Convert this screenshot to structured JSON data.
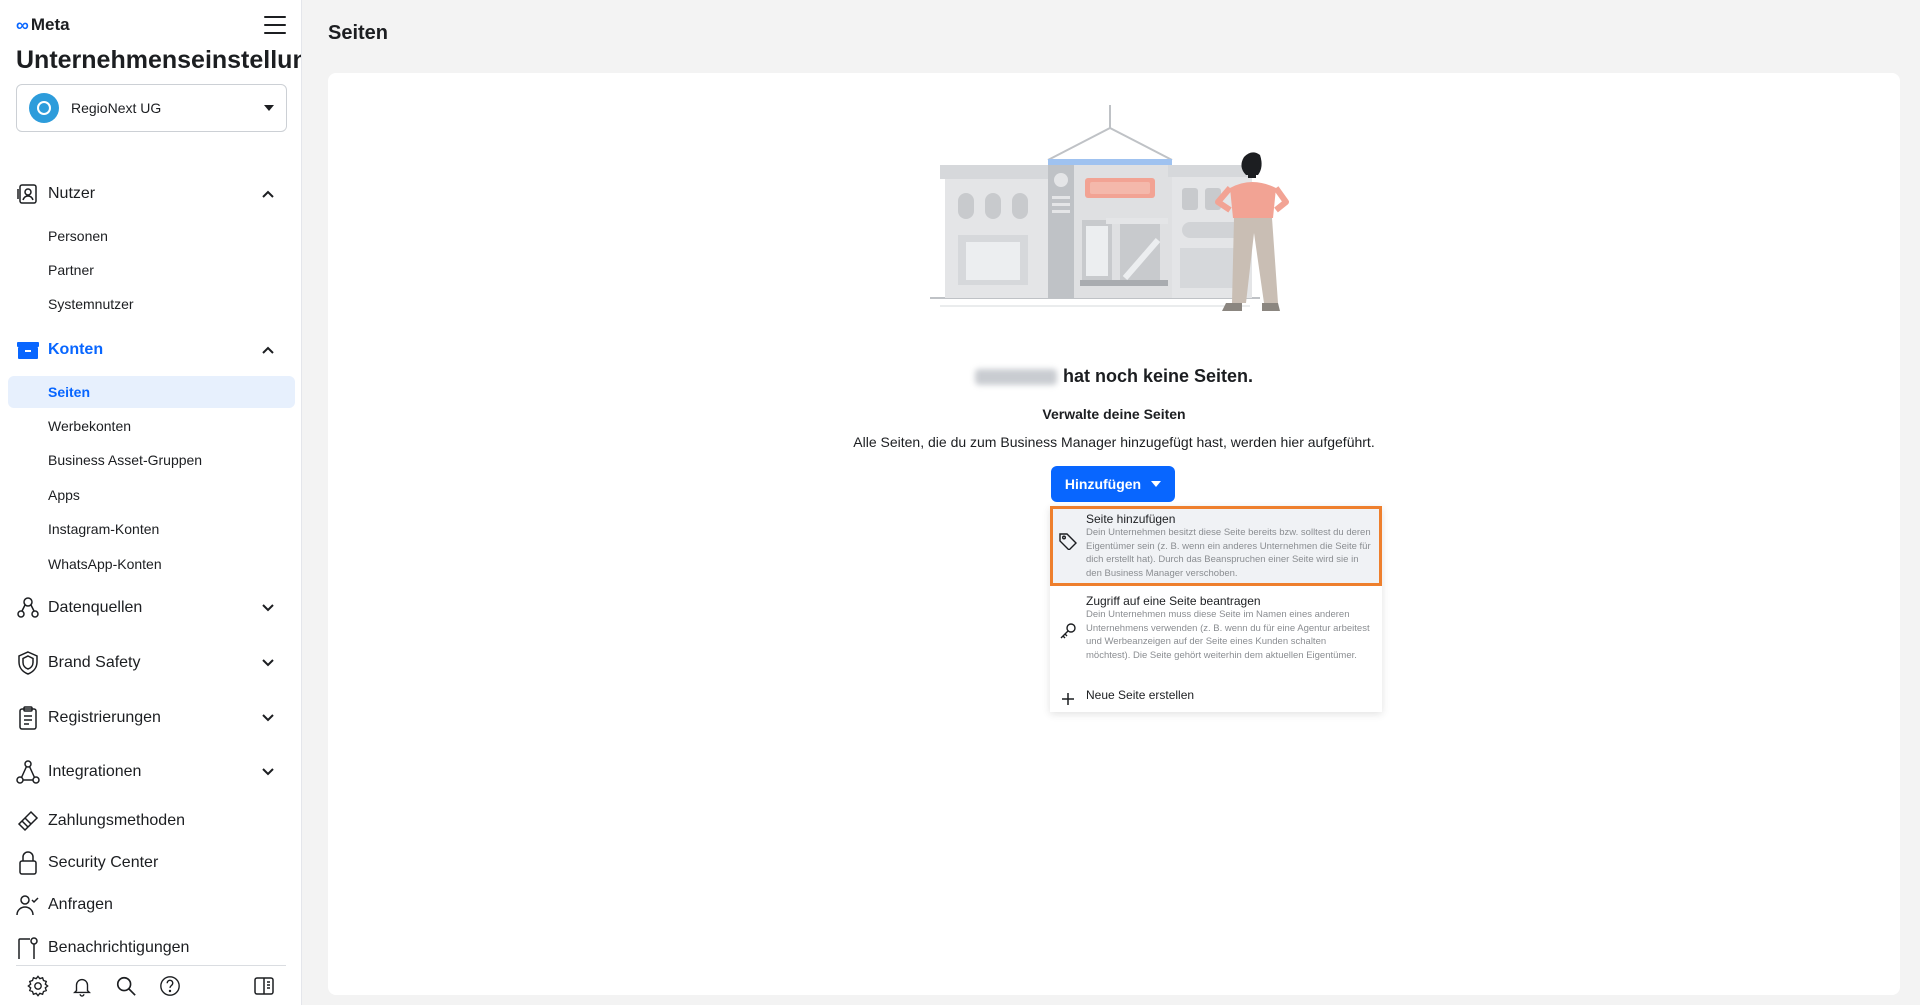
{
  "sidebar": {
    "logo_text": "Meta",
    "title": "Unternehmenseinstellungen",
    "business_name": "RegioNext UG",
    "sections": [
      {
        "id": "nutzer",
        "label": "Nutzer",
        "icon": "users-badge-icon",
        "expanded": true
      },
      {
        "id": "konten",
        "label": "Konten",
        "icon": "folder-icon",
        "expanded": true
      },
      {
        "id": "datenquellen",
        "label": "Datenquellen",
        "icon": "data-sources-icon",
        "expanded": false
      },
      {
        "id": "brand-safety",
        "label": "Brand Safety",
        "icon": "shield-icon",
        "expanded": false
      },
      {
        "id": "registrierungen",
        "label": "Registrierungen",
        "icon": "clipboard-icon",
        "expanded": false
      },
      {
        "id": "integrationen",
        "label": "Integrationen",
        "icon": "integrations-icon",
        "expanded": false
      },
      {
        "id": "zahlungsmethoden",
        "label": "Zahlungsmethoden",
        "icon": "credit-card-icon"
      },
      {
        "id": "security-center",
        "label": "Security Center",
        "icon": "lock-icon"
      },
      {
        "id": "anfragen",
        "label": "Anfragen",
        "icon": "person-check-icon"
      },
      {
        "id": "benachrichtigungen",
        "label": "Benachrichtigungen",
        "icon": "notification-icon"
      }
    ],
    "nutzer_items": [
      "Personen",
      "Partner",
      "Systemnutzer"
    ],
    "konten_items": [
      "Seiten",
      "Werbekonten",
      "Business Asset-Gruppen",
      "Apps",
      "Instagram-Konten",
      "WhatsApp-Konten"
    ],
    "active_item": "Seiten",
    "footer_icons": [
      "settings-icon",
      "bell-icon",
      "search-icon",
      "help-icon",
      "panel-toggle-icon"
    ]
  },
  "main": {
    "page_title": "Seiten",
    "empty_title": "hat noch keine Seiten.",
    "manage_title": "Verwalte deine Seiten",
    "manage_desc": "Alle Seiten, die du zum Business Manager hinzugefügt hast, werden hier aufgeführt.",
    "add_button": "Hinzufügen",
    "dropdown": [
      {
        "title": "Seite hinzufügen",
        "icon": "tag-icon",
        "desc": "Dein Unternehmen besitzt diese Seite bereits bzw. solltest du deren Eigentümer sein (z. B. wenn ein anderes Unternehmen die Seite für dich erstellt hat). Durch das Beanspruchen einer Seite wird sie in den Business Manager verschoben.",
        "highlighted": true
      },
      {
        "title": "Zugriff auf eine Seite beantragen",
        "icon": "key-icon",
        "desc": "Dein Unternehmen muss diese Seite im Namen eines anderen Unternehmens verwenden (z. B. wenn du für eine Agentur arbeitest und Werbeanzeigen auf der Seite eines Kunden schalten möchtest). Die Seite gehört weiterhin dem aktuellen Eigentümer.",
        "highlighted": false
      },
      {
        "title": "Neue Seite erstellen",
        "icon": "plus-icon",
        "desc": "",
        "highlighted": false
      }
    ]
  },
  "colors": {
    "accent": "#0866ff",
    "highlight_border": "#ee7f2d",
    "active_bg": "#e7f0fd",
    "illustration_salmon": "#f2a394",
    "illustration_blue": "#9fc2f0"
  }
}
